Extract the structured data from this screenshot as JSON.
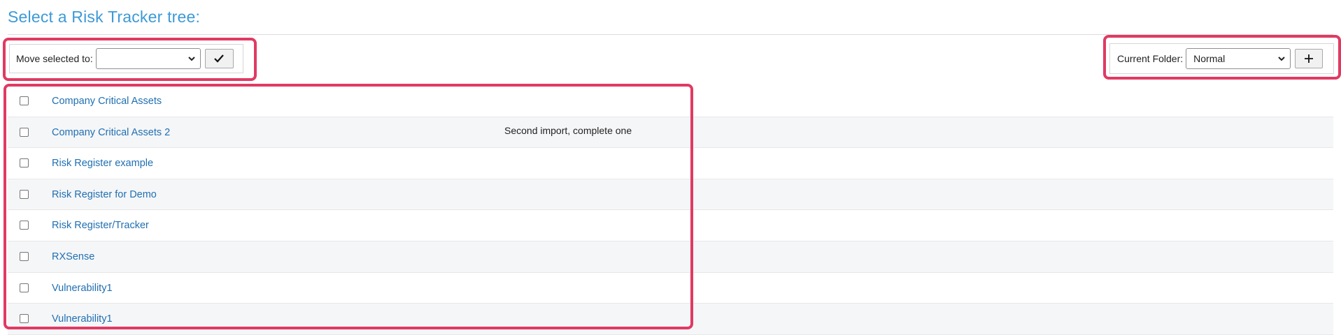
{
  "page": {
    "title": "Select a Risk Tracker tree:"
  },
  "move_toolbar": {
    "label": "Move selected to:",
    "selected_value": "",
    "confirm_icon": "checkmark-icon"
  },
  "folder_toolbar": {
    "label": "Current Folder:",
    "selected_value": "Normal",
    "add_icon": "plus-icon"
  },
  "trees": [
    {
      "name": "Company Critical Assets",
      "description": ""
    },
    {
      "name": "Company Critical Assets 2",
      "description": "Second import, complete one"
    },
    {
      "name": "Risk Register example",
      "description": ""
    },
    {
      "name": "Risk Register for Demo",
      "description": ""
    },
    {
      "name": "Risk Register/Tracker",
      "description": ""
    },
    {
      "name": "RXSense",
      "description": ""
    },
    {
      "name": "Vulnerability1",
      "description": ""
    },
    {
      "name": "Vulnerability1",
      "description": ""
    }
  ],
  "colors": {
    "title": "#3d9ad6",
    "link": "#1f6fb2",
    "highlight": "#e03a62",
    "row_alt": "#f5f6f8"
  }
}
